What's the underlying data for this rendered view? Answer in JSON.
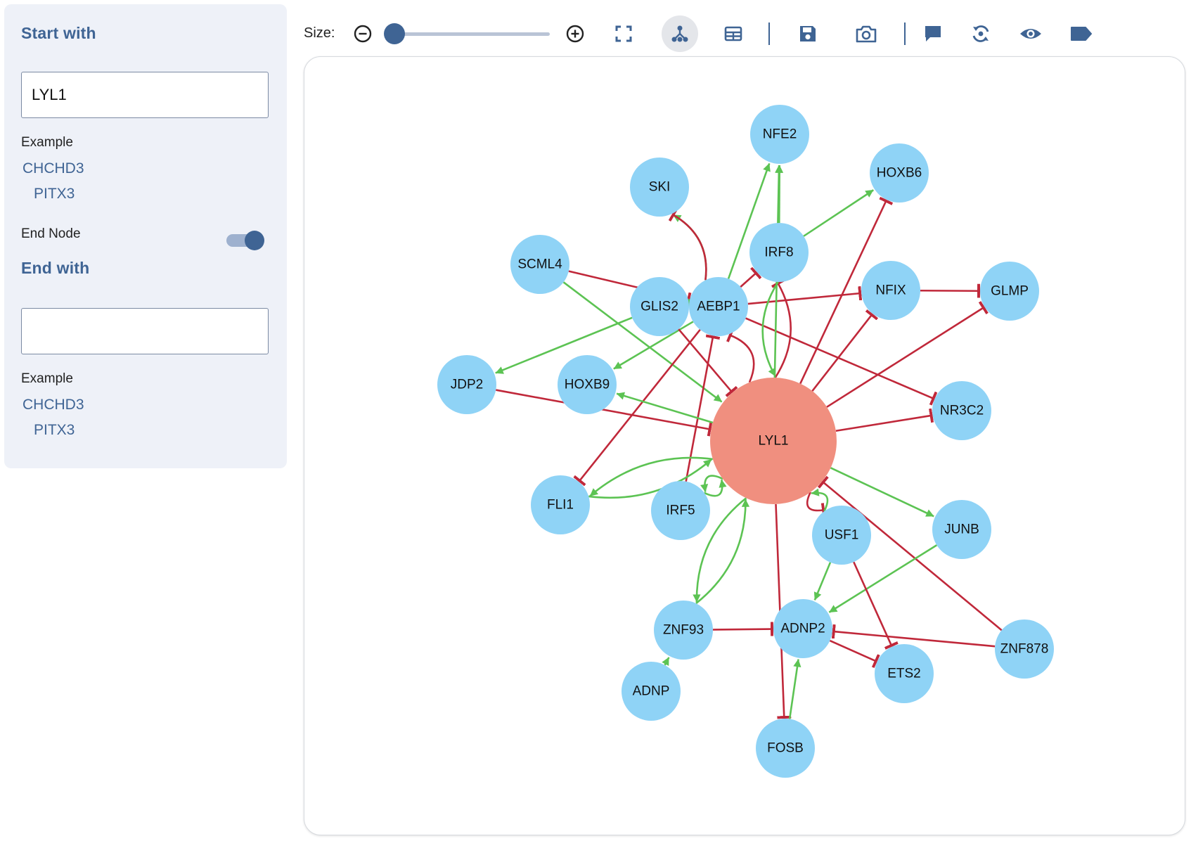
{
  "sidebar": {
    "start_title": "Start with",
    "start_value": "LYL1",
    "start_example_label": "Example",
    "start_examples": [
      "CHCHD3",
      "PITX3"
    ],
    "end_node_label": "End Node",
    "end_node_enabled": true,
    "end_title": "End with",
    "end_value": "",
    "end_example_label": "Example",
    "end_examples": [
      "CHCHD3",
      "PITX3"
    ]
  },
  "toolbar": {
    "size_label": "Size:",
    "size_level": 0,
    "active_view": "network",
    "icons": [
      "zoom-out-icon",
      "zoom-in-icon",
      "fit-screen-icon",
      "network-view-icon",
      "table-view-icon",
      "save-icon",
      "camera-icon",
      "comment-icon",
      "reset-layout-icon",
      "eye-icon",
      "label-icon"
    ]
  },
  "colors": {
    "activation": "#5cc353",
    "inhibition": "#c0283a",
    "node": "#8fd3f6",
    "center_node": "#f08f7f",
    "accent": "#3f6494"
  },
  "graph": {
    "center": "LYL1",
    "nodes": [
      "LYL1",
      "NFE2",
      "SKI",
      "HOXB6",
      "IRF8",
      "SCML4",
      "GLIS2",
      "AEBP1",
      "NFIX",
      "GLMP",
      "JDP2",
      "HOXB9",
      "NR3C2",
      "FLI1",
      "IRF5",
      "USF1",
      "JUNB",
      "ZNF93",
      "ADNP2",
      "ZNF878",
      "ETS2",
      "ADNP",
      "FOSB"
    ],
    "edges": [
      {
        "source": "SCML4",
        "target": "AEBP1",
        "type": "inhibition"
      },
      {
        "source": "SCML4",
        "target": "LYL1",
        "type": "activation"
      },
      {
        "source": "AEBP1",
        "target": "SKI",
        "type": "activation"
      },
      {
        "source": "AEBP1",
        "target": "SKI",
        "type": "inhibition"
      },
      {
        "source": "AEBP1",
        "target": "NFE2",
        "type": "activation"
      },
      {
        "source": "IRF8",
        "target": "NFE2",
        "type": "activation"
      },
      {
        "source": "IRF8",
        "target": "HOXB6",
        "type": "activation"
      },
      {
        "source": "AEBP1",
        "target": "IRF8",
        "type": "inhibition"
      },
      {
        "source": "AEBP1",
        "target": "NFIX",
        "type": "inhibition"
      },
      {
        "source": "AEBP1",
        "target": "GLIS2",
        "type": "activation"
      },
      {
        "source": "NFIX",
        "target": "GLMP",
        "type": "inhibition"
      },
      {
        "source": "GLIS2",
        "target": "JDP2",
        "type": "activation"
      },
      {
        "source": "AEBP1",
        "target": "HOXB9",
        "type": "activation"
      },
      {
        "source": "GLIS2",
        "target": "LYL1",
        "type": "inhibition"
      },
      {
        "source": "AEBP1",
        "target": "NR3C2",
        "type": "inhibition"
      },
      {
        "source": "AEBP1",
        "target": "FLI1",
        "type": "inhibition"
      },
      {
        "source": "IRF5",
        "target": "AEBP1",
        "type": "inhibition"
      },
      {
        "source": "LYL1",
        "target": "AEBP1",
        "type": "inhibition"
      },
      {
        "source": "LYL1",
        "target": "IRF8",
        "type": "inhibition"
      },
      {
        "source": "IRF8",
        "target": "LYL1",
        "type": "activation"
      },
      {
        "source": "LYL1",
        "target": "NFE2",
        "type": "activation"
      },
      {
        "source": "LYL1",
        "target": "HOXB6",
        "type": "inhibition"
      },
      {
        "source": "LYL1",
        "target": "NFIX",
        "type": "inhibition"
      },
      {
        "source": "LYL1",
        "target": "GLMP",
        "type": "inhibition"
      },
      {
        "source": "LYL1",
        "target": "NR3C2",
        "type": "inhibition"
      },
      {
        "source": "JDP2",
        "target": "LYL1",
        "type": "inhibition"
      },
      {
        "source": "LYL1",
        "target": "HOXB9",
        "type": "activation"
      },
      {
        "source": "LYL1",
        "target": "FLI1",
        "type": "activation"
      },
      {
        "source": "FLI1",
        "target": "LYL1",
        "type": "activation"
      },
      {
        "source": "LYL1",
        "target": "IRF5",
        "type": "activation"
      },
      {
        "source": "IRF5",
        "target": "LYL1",
        "type": "activation"
      },
      {
        "source": "LYL1",
        "target": "JUNB",
        "type": "activation"
      },
      {
        "source": "LYL1",
        "target": "USF1",
        "type": "inhibition"
      },
      {
        "source": "USF1",
        "target": "LYL1",
        "type": "activation"
      },
      {
        "source": "ZNF878",
        "target": "LYL1",
        "type": "inhibition"
      },
      {
        "source": "LYL1",
        "target": "ZNF93",
        "type": "activation"
      },
      {
        "source": "ZNF93",
        "target": "LYL1",
        "type": "activation"
      },
      {
        "source": "LYL1",
        "target": "FOSB",
        "type": "inhibition"
      },
      {
        "source": "USF1",
        "target": "ADNP2",
        "type": "activation"
      },
      {
        "source": "JUNB",
        "target": "ADNP2",
        "type": "activation"
      },
      {
        "source": "USF1",
        "target": "ETS2",
        "type": "inhibition"
      },
      {
        "source": "ZNF93",
        "target": "ADNP2",
        "type": "inhibition"
      },
      {
        "source": "ZNF878",
        "target": "ADNP2",
        "type": "inhibition"
      },
      {
        "source": "ADNP2",
        "target": "ETS2",
        "type": "inhibition"
      },
      {
        "source": "FOSB",
        "target": "ADNP2",
        "type": "activation"
      },
      {
        "source": "ADNP",
        "target": "ZNF93",
        "type": "activation"
      }
    ]
  }
}
